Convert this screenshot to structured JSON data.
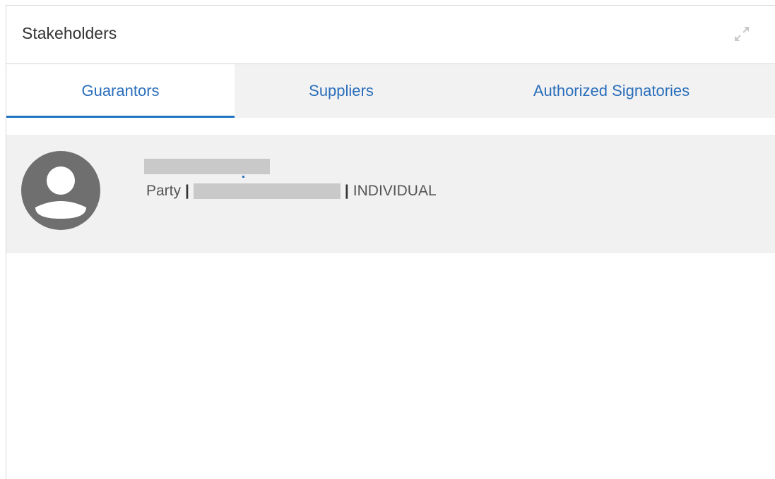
{
  "panel": {
    "title": "Stakeholders",
    "expand_icon": "expand-icon"
  },
  "tabs": [
    {
      "label": "Guarantors",
      "active": true
    },
    {
      "label": "Suppliers",
      "active": false
    },
    {
      "label": "Authorized Signatories",
      "active": false
    }
  ],
  "colors": {
    "accent": "#1f74c4",
    "tab_text": "#2a6ebb",
    "tab_bar_bg": "#f2f2f2",
    "row_bg": "#f1f1f1",
    "avatar": "#6f6f6f"
  },
  "guarantors": [
    {
      "avatar_icon": "user-avatar-icon",
      "type_label": "Party",
      "separator": "|",
      "category": "INDIVIDUAL"
    }
  ]
}
